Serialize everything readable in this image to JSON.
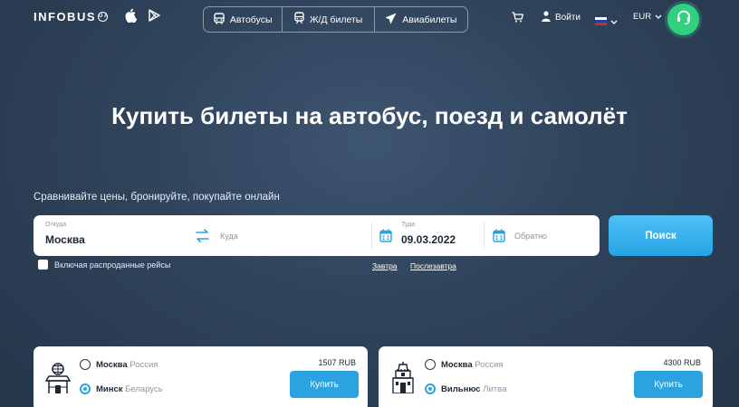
{
  "header": {
    "logo_text": "INFOBUS",
    "logo_badge": "UA",
    "tabs": [
      {
        "label": "Автобусы",
        "icon": "bus-icon"
      },
      {
        "label": "Ж/Д билеты",
        "icon": "train-icon"
      },
      {
        "label": "Авиабилеты",
        "icon": "plane-icon"
      }
    ],
    "login_label": "Войти",
    "currency": "EUR",
    "flag_colors": [
      "#ffffff",
      "#1c3faa",
      "#d52b1e"
    ],
    "accent_color": "#2fd07e"
  },
  "hero": {
    "title": "Купить билеты на автобус, поезд и самолёт",
    "subtitle": "Сравнивайте цены, бронируйте, покупайте онлайн"
  },
  "search": {
    "from_label": "Откуда",
    "from_value": "Москва",
    "to_placeholder": "Куда",
    "date_label": "Туда",
    "date_value": "09.03.2022",
    "return_placeholder": "Обратно",
    "search_button": "Поиск",
    "sold_out_label": "Включая распроданные рейсы",
    "tomorrow_link": "Завтра",
    "day_after_link": "Послезавтра"
  },
  "routes": [
    {
      "from_city": "Москва",
      "from_country": "Россия",
      "to_city": "Минск",
      "to_country": "Беларусь",
      "price": "1507 RUB",
      "buy_label": "Купить"
    },
    {
      "from_city": "Москва",
      "from_country": "Россия",
      "to_city": "Вильнюс",
      "to_country": "Литва",
      "price": "4300 RUB",
      "buy_label": "Купить"
    }
  ]
}
